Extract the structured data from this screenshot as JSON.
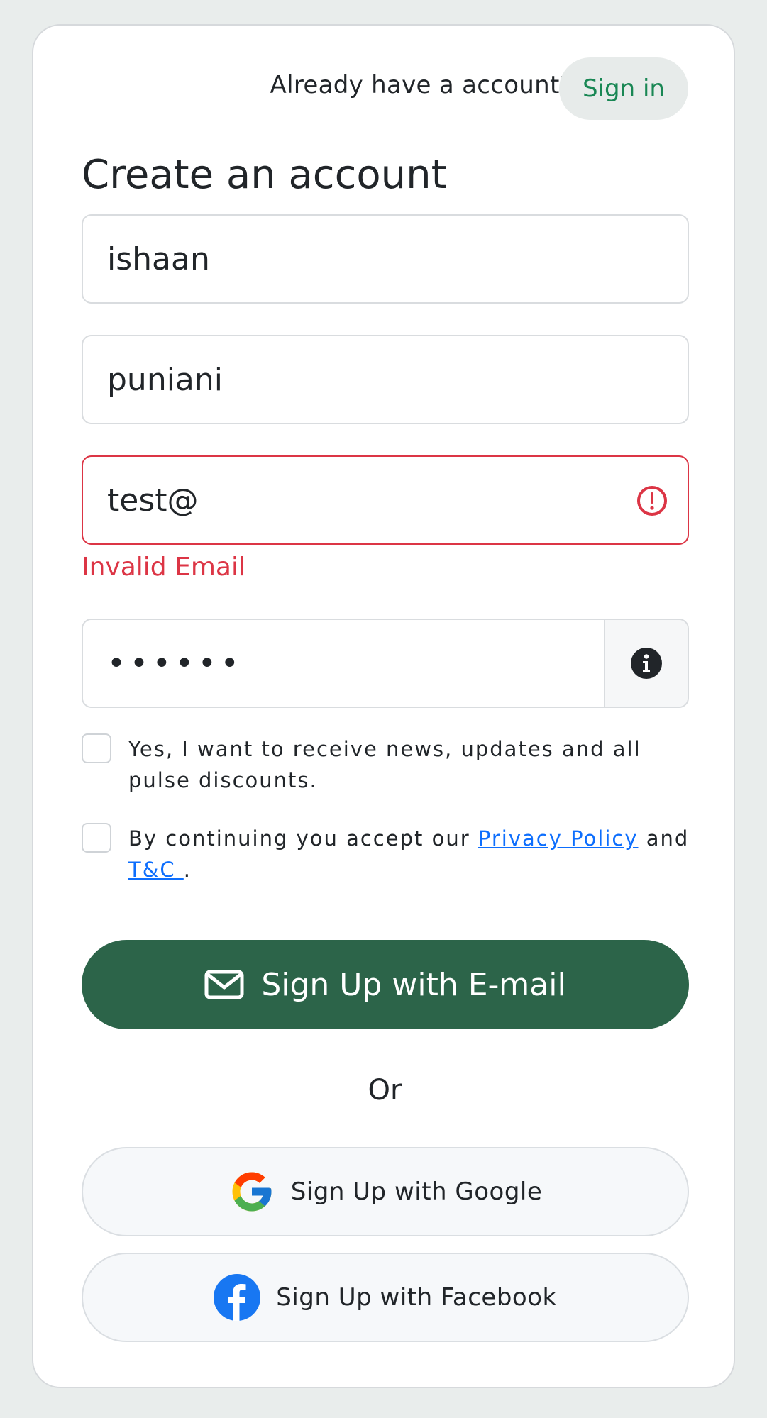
{
  "header": {
    "already_text": "Already have a account?",
    "signin_label": "Sign in"
  },
  "form": {
    "title": "Create an account",
    "first_name": "ishaan",
    "last_name": "puniani",
    "email": "test@",
    "email_error": "Invalid Email",
    "password_masked": "••••••",
    "newsletter_text": "Yes, I want to receive news, updates and all pulse discounts.",
    "terms_prefix": "By continuing you accept our ",
    "privacy_link": "Privacy Policy",
    "terms_mid": " and ",
    "tc_link": "T&C ",
    "terms_suffix": "."
  },
  "actions": {
    "email_signup": "Sign Up with E-mail",
    "or": "Or",
    "google_signup": "Sign Up with Google",
    "facebook_signup": "Sign Up with Facebook"
  },
  "colors": {
    "primary": "#2c6449",
    "link": "#0d6efd",
    "error": "#dc3545",
    "signin_text": "#198754"
  }
}
